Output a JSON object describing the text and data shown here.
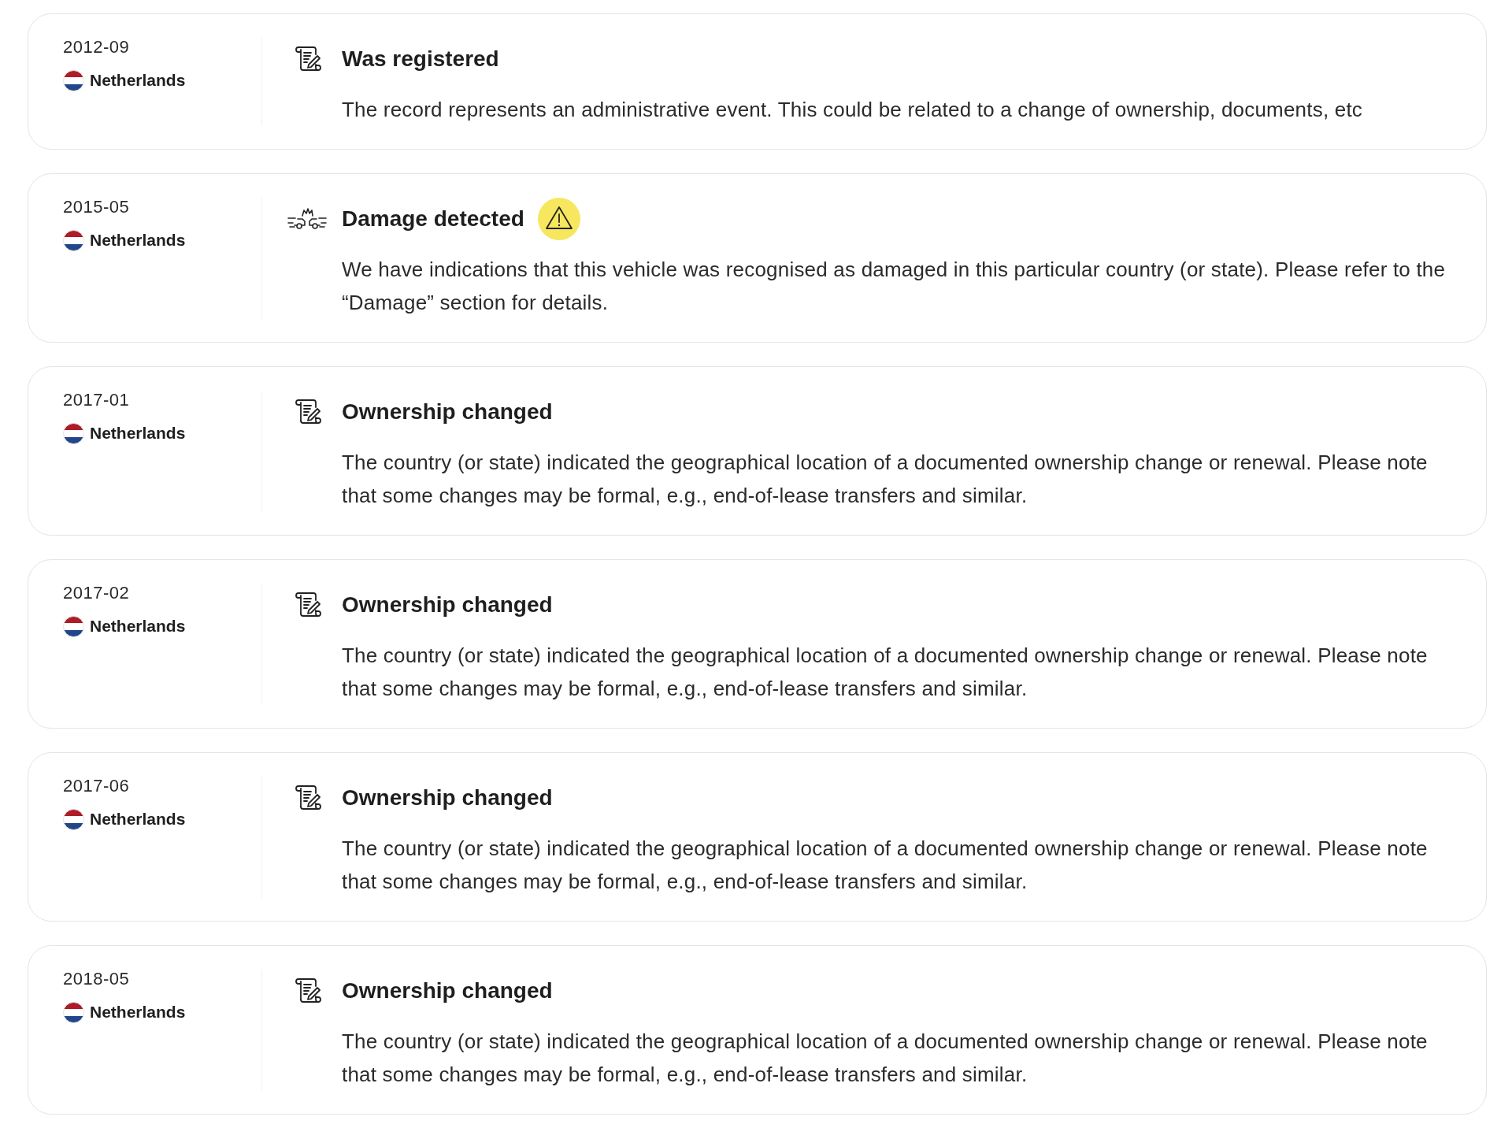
{
  "events": [
    {
      "date": "2012-09",
      "country": "Netherlands",
      "kind": "document",
      "title": "Was registered",
      "warning": false,
      "description": "The record represents an administrative event. This could be related to a change of ownership, documents, etc"
    },
    {
      "date": "2015-05",
      "country": "Netherlands",
      "kind": "damage",
      "title": "Damage detected",
      "warning": true,
      "description": "We have indications that this vehicle was recognised as damaged in this particular country (or state). Please refer to the “Damage” section for details."
    },
    {
      "date": "2017-01",
      "country": "Netherlands",
      "kind": "document",
      "title": "Ownership changed",
      "warning": false,
      "description": "The country (or state) indicated the geographical location of a documented ownership change or renewal. Please note that some changes may be formal, e.g., end-of-lease transfers and similar."
    },
    {
      "date": "2017-02",
      "country": "Netherlands",
      "kind": "document",
      "title": "Ownership changed",
      "warning": false,
      "description": "The country (or state) indicated the geographical location of a documented ownership change or renewal. Please note that some changes may be formal, e.g., end-of-lease transfers and similar."
    },
    {
      "date": "2017-06",
      "country": "Netherlands",
      "kind": "document",
      "title": "Ownership changed",
      "warning": false,
      "description": "The country (or state) indicated the geographical location of a documented ownership change or renewal. Please note that some changes may be formal, e.g., end-of-lease transfers and similar."
    },
    {
      "date": "2018-05",
      "country": "Netherlands",
      "kind": "document",
      "title": "Ownership changed",
      "warning": false,
      "description": "The country (or state) indicated the geographical location of a documented ownership change or renewal. Please note that some changes may be formal, e.g., end-of-lease transfers and similar."
    }
  ]
}
